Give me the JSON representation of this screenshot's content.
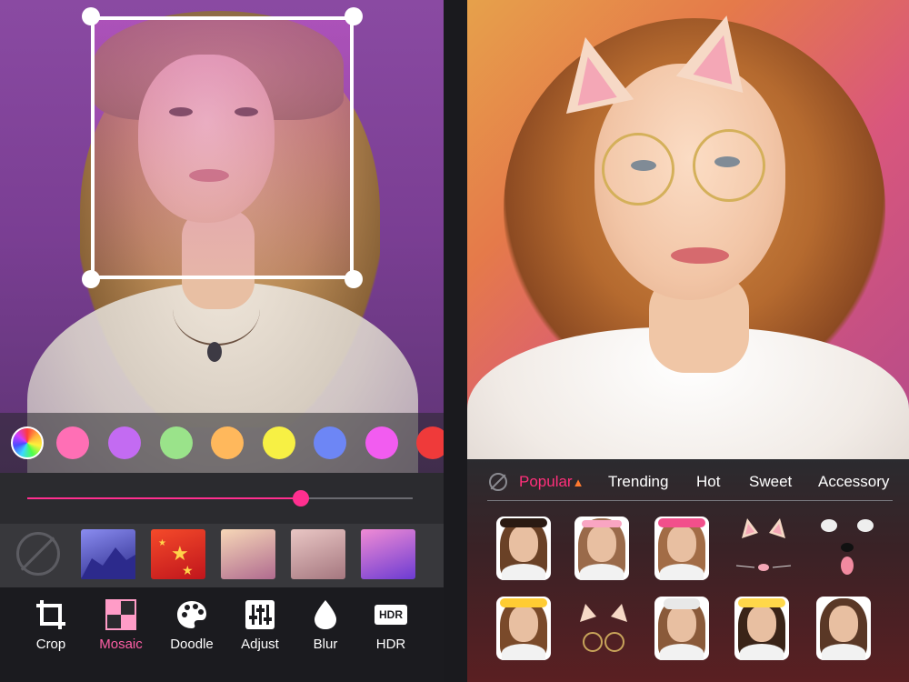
{
  "left_screen": {
    "colors": [
      "#ff6fb5",
      "#c36bf2",
      "#9ae38a",
      "#ffb85c",
      "#f7f044",
      "#6d86f5",
      "#f25cf0",
      "#ef3a3a"
    ],
    "slider": {
      "value_fraction": 0.71,
      "accent": "#ff2f8f"
    },
    "patterns": [
      {
        "name": "mountain-blue",
        "c1": "#8a8cf0",
        "c2": "#2b2a8a"
      },
      {
        "name": "red-stars",
        "c1": "#f44a2a",
        "c2": "#c0151c"
      },
      {
        "name": "golden-bokeh",
        "c1": "#f6d7b7",
        "c2": "#b06b8f"
      },
      {
        "name": "soft-pink",
        "c1": "#e9c6c4",
        "c2": "#a5777f"
      },
      {
        "name": "purple-bokeh",
        "c1": "#f08bd5",
        "c2": "#6c3bd2"
      }
    ],
    "tools": [
      {
        "label": "Crop",
        "icon": "crop-icon"
      },
      {
        "label": "Mosaic",
        "icon": "mosaic-icon",
        "active": true
      },
      {
        "label": "Doodle",
        "icon": "palette-icon"
      },
      {
        "label": "Adjust",
        "icon": "sliders-icon"
      },
      {
        "label": "Blur",
        "icon": "drop-icon"
      },
      {
        "label": "HDR",
        "icon": "hdr-icon",
        "badge": "HDR"
      }
    ]
  },
  "right_screen": {
    "tabs": [
      {
        "label": "Popular",
        "active": true,
        "icon": "fire-icon"
      },
      {
        "label": "Trending"
      },
      {
        "label": "Hot"
      },
      {
        "label": "Sweet"
      },
      {
        "label": "Accessory"
      }
    ],
    "accent": "#ff2f7a"
  }
}
